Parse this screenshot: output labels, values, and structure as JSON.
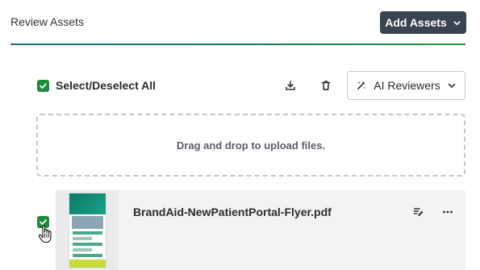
{
  "header": {
    "title": "Review Assets",
    "add_assets_label": "Add Assets"
  },
  "toolbar": {
    "select_all_label": "Select/Deselect All",
    "select_all_checked": true,
    "ai_reviewers_label": "AI Reviewers"
  },
  "dropzone": {
    "text": "Drag and drop to upload files."
  },
  "assets": [
    {
      "name": "BrandAid-NewPatientPortal-Flyer.pdf",
      "checked": true
    }
  ],
  "colors": {
    "accent_green": "#1e8a3c",
    "dark_button": "#3a4450",
    "divider_start": "#1d6a8a",
    "divider_end": "#2e8b3d"
  },
  "icons": {
    "add_assets": "chevron-down-icon",
    "download": "download-icon",
    "delete": "trash-icon",
    "ai_reviewers": "ai-sparkle-icon",
    "ai_dropdown": "chevron-down-icon",
    "edit": "edit-note-icon",
    "more": "more-horizontal-icon",
    "cursor": "pointer-hand-cursor-icon"
  }
}
